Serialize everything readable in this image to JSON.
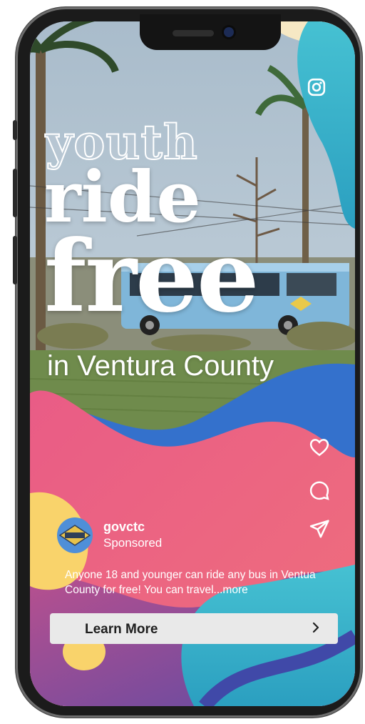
{
  "ad": {
    "headline_line1": "youth",
    "headline_line2": "ride",
    "headline_line3": "free",
    "headline_location": "in Ventura County"
  },
  "post": {
    "username": "govctc",
    "sponsored_label": "Sponsored",
    "avatar_text": "VCTC",
    "caption": "Anyone 18 and younger can ride any bus in Ventua County for free! You can travel...more"
  },
  "cta": {
    "label": "Learn More"
  },
  "icons": {
    "top": "instagram-icon",
    "actions": [
      "heart-icon",
      "comment-icon",
      "send-icon"
    ],
    "cta": "chevron-right-icon"
  },
  "colors": {
    "pink": "#e95c86",
    "blue": "#2f6fd1",
    "teal": "#38b7c7",
    "yellow": "#f9d36b",
    "purple": "#6b4aa0"
  }
}
